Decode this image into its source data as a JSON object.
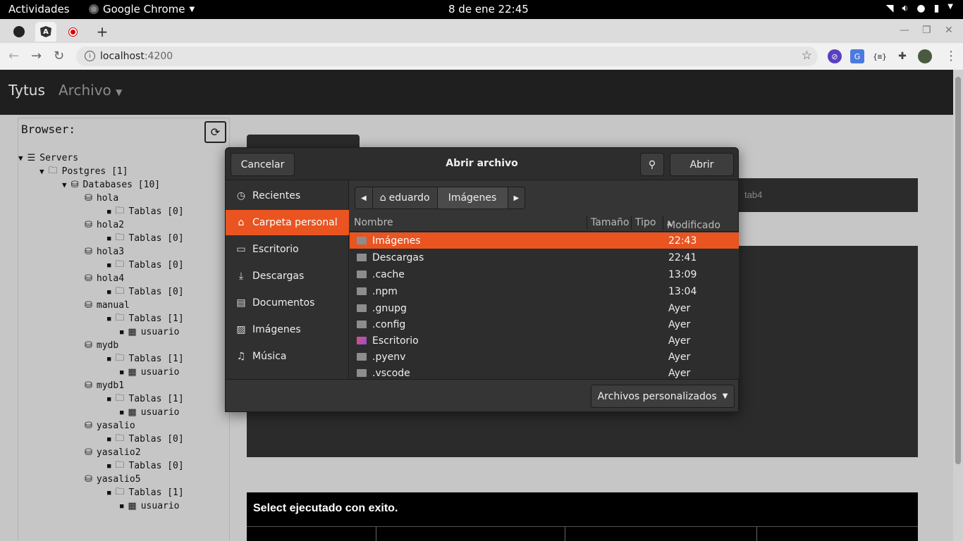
{
  "system_bar": {
    "activities": "Actividades",
    "app_name": "Google Chrome",
    "clock": "8 de ene  22:45"
  },
  "browser": {
    "url_host": "localhost",
    "url_port": ":4200"
  },
  "app": {
    "brand": "Tytus",
    "menu": "Archivo",
    "browser_title": "Browser:",
    "tab4": "tab4",
    "result_message": "Select ejecutado con exito."
  },
  "tree": {
    "servers": "Servers",
    "postgres": "Postgres [1]",
    "databases": "Databases [10]",
    "items": [
      {
        "db": "hola",
        "tables": "Tablas [0]",
        "child": ""
      },
      {
        "db": "hola2",
        "tables": "Tablas [0]",
        "child": ""
      },
      {
        "db": "hola3",
        "tables": "Tablas [0]",
        "child": ""
      },
      {
        "db": "hola4",
        "tables": "Tablas [0]",
        "child": ""
      },
      {
        "db": "manual",
        "tables": "Tablas [1]",
        "child": "usuario"
      },
      {
        "db": "mydb",
        "tables": "Tablas [1]",
        "child": "usuario"
      },
      {
        "db": "mydb1",
        "tables": "Tablas [1]",
        "child": "usuario"
      },
      {
        "db": "yasalio",
        "tables": "Tablas [0]",
        "child": ""
      },
      {
        "db": "yasalio2",
        "tables": "Tablas [0]",
        "child": ""
      },
      {
        "db": "yasalio5",
        "tables": "Tablas [1]",
        "child": "usuario"
      }
    ]
  },
  "dialog": {
    "title": "Abrir archivo",
    "cancel": "Cancelar",
    "open": "Abrir",
    "places": [
      {
        "label": "Recientes",
        "icon": "clock-icon"
      },
      {
        "label": "Carpeta personal",
        "icon": "home-icon"
      },
      {
        "label": "Escritorio",
        "icon": "desktop-icon"
      },
      {
        "label": "Descargas",
        "icon": "download-icon"
      },
      {
        "label": "Documentos",
        "icon": "document-icon"
      },
      {
        "label": "Imágenes",
        "icon": "image-icon"
      },
      {
        "label": "Música",
        "icon": "music-icon"
      }
    ],
    "crumb_home": "eduardo",
    "crumb_current": "Imágenes",
    "columns": {
      "name": "Nombre",
      "size": "Tamaño",
      "type": "Tipo",
      "modified": "Modificado"
    },
    "files": [
      {
        "name": "Imágenes",
        "modified": "22:43"
      },
      {
        "name": "Descargas",
        "modified": "22:41"
      },
      {
        "name": ".cache",
        "modified": "13:09"
      },
      {
        "name": ".npm",
        "modified": "13:04"
      },
      {
        "name": ".gnupg",
        "modified": "Ayer"
      },
      {
        "name": ".config",
        "modified": "Ayer"
      },
      {
        "name": "Escritorio",
        "modified": "Ayer"
      },
      {
        "name": ".pyenv",
        "modified": "Ayer"
      },
      {
        "name": ".vscode",
        "modified": "Ayer"
      }
    ],
    "filter": "Archivos personalizados"
  }
}
